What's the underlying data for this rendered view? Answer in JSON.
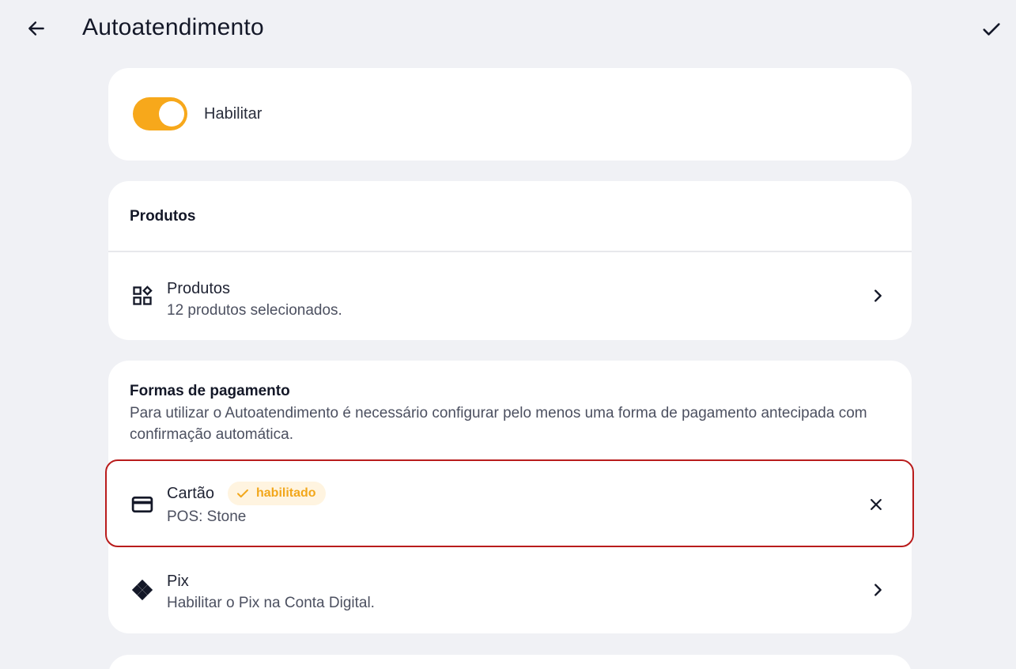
{
  "header": {
    "title": "Autoatendimento",
    "back_icon": "arrow-left-icon",
    "confirm_icon": "check-icon"
  },
  "enable": {
    "label": "Habilitar",
    "enabled": true,
    "accent_color": "#f7a81b"
  },
  "products": {
    "section_title": "Produtos",
    "row": {
      "title": "Produtos",
      "subtitle": "12 produtos selecionados.",
      "icon": "grid-shapes-icon",
      "action_icon": "chevron-right-icon"
    }
  },
  "payments": {
    "section_title": "Formas de pagamento",
    "description": "Para utilizar o Autoatendimento é necessário configurar pelo menos uma forma de pagamento antecipada com confirmação automática.",
    "methods": [
      {
        "title": "Cartão",
        "badge": "habilitado",
        "subtitle": "POS: Stone",
        "icon": "credit-card-icon",
        "action_icon": "close-icon",
        "highlight_color": "#b91c1c"
      },
      {
        "title": "Pix",
        "subtitle": "Habilitar o Pix na Conta Digital.",
        "icon": "pix-icon",
        "action_icon": "chevron-right-icon"
      }
    ]
  }
}
